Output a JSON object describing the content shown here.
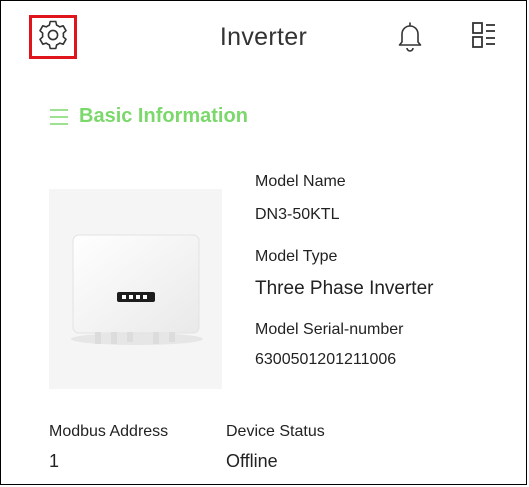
{
  "header": {
    "title": "Inverter",
    "settings_icon": "gear-icon",
    "notification_icon": "bell-icon",
    "menu_icon": "grid-list-icon",
    "highlight_color": "#e0141b"
  },
  "section": {
    "title": "Basic Information",
    "icon": "list-lines-icon",
    "accent_color": "#7bd86b"
  },
  "device": {
    "model_name_label": "Model Name",
    "model_name_value": "DN3-50KTL",
    "model_type_label": "Model Type",
    "model_type_value": "Three Phase Inverter",
    "serial_label": "Model Serial-number",
    "serial_value": "6300501201211006"
  },
  "fields": {
    "modbus_label": "Modbus Address",
    "modbus_value": "1",
    "status_label": "Device Status",
    "status_value": "Offline"
  }
}
